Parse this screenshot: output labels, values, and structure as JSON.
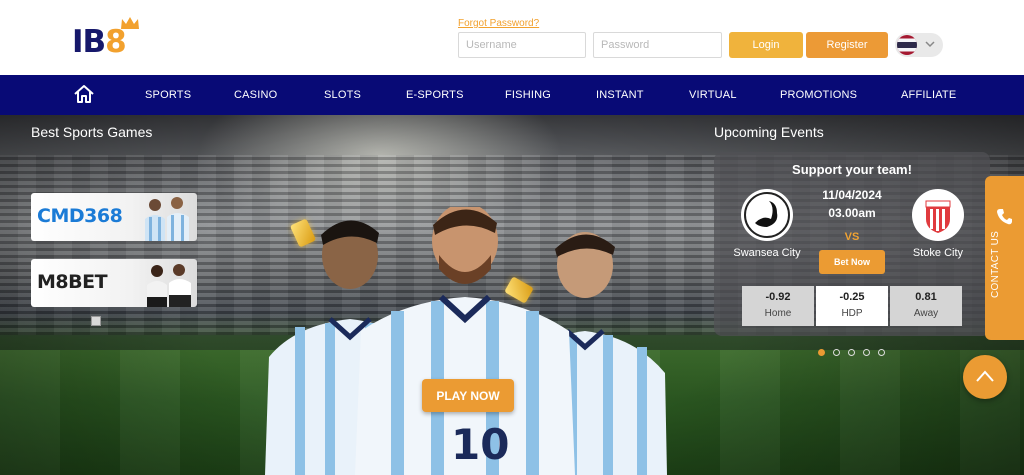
{
  "brand": {
    "logo_text_prefix": "IB",
    "logo_text_suffix": "8",
    "accent_color": "#eb9b33",
    "nav_color": "#080a76"
  },
  "header": {
    "forgot_password": "Forgot Password?",
    "username_placeholder": "Username",
    "password_placeholder": "Password",
    "login_label": "Login",
    "register_label": "Register",
    "language_flag": "thailand-flag-icon"
  },
  "nav": {
    "home_icon": "home-icon",
    "items": [
      {
        "label": "SPORTS"
      },
      {
        "label": "CASINO"
      },
      {
        "label": "SLOTS"
      },
      {
        "label": "E-SPORTS"
      },
      {
        "label": "FISHING"
      },
      {
        "label": "INSTANT"
      },
      {
        "label": "VIRTUAL"
      },
      {
        "label": "PROMOTIONS"
      },
      {
        "label": "AFFILIATE"
      }
    ]
  },
  "hero": {
    "best_sports_title": "Best Sports Games",
    "partners": [
      {
        "name": "CMD368"
      },
      {
        "name": "M8BET"
      }
    ],
    "play_now_label": "PLAY NOW",
    "carousel": {
      "total_slides": 5,
      "active_slide": 1
    }
  },
  "upcoming": {
    "title": "Upcoming Events",
    "card_title": "Support your team!",
    "date": "11/04/2024",
    "time": "03.00am",
    "vs_label": "VS",
    "home_team": "Swansea City",
    "away_team": "Stoke City",
    "bet_label": "Bet Now",
    "odds": [
      {
        "value": "-0.92",
        "label": "Home"
      },
      {
        "value": "-0.25",
        "label": "HDP"
      },
      {
        "value": "0.81",
        "label": "Away"
      }
    ]
  },
  "sidebar": {
    "contact_label": "CONTACT US"
  }
}
